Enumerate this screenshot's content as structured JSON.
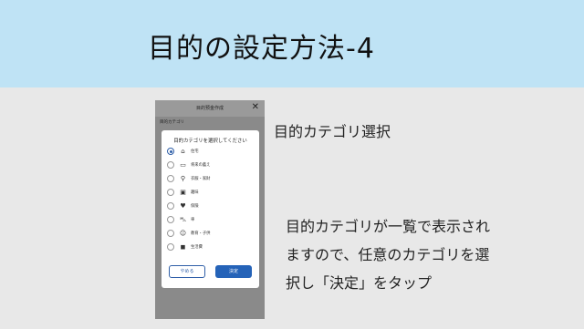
{
  "header": {
    "title": "目的の設定方法-4"
  },
  "phone": {
    "top_title": "目的预金作成",
    "close_glyph": "✕",
    "field_label": "目的カテゴリ",
    "modal": {
      "title": "目的カテゴリを選択してください",
      "options": [
        {
          "icon": "house-icon",
          "glyph": "⌂",
          "label": "住宅"
        },
        {
          "icon": "sofa-icon",
          "glyph": "▭",
          "label": "将来の蓄え"
        },
        {
          "icon": "cart-icon",
          "glyph": "⚲",
          "label": "衣服・家財"
        },
        {
          "icon": "image-icon",
          "glyph": "▣",
          "label": "趣味"
        },
        {
          "icon": "heart-icon",
          "glyph": "♥",
          "label": "保険"
        },
        {
          "icon": "car-icon",
          "glyph": "⛍",
          "label": "車"
        },
        {
          "icon": "family-icon",
          "glyph": "☺",
          "label": "教育・子供"
        },
        {
          "icon": "bag-icon",
          "glyph": "◼",
          "label": "生活費"
        }
      ],
      "selected_index": 0,
      "cancel_label": "やめる",
      "confirm_label": "決定"
    }
  },
  "side": {
    "heading": "目的カテゴリ選択",
    "desc_lines": [
      "目的カテゴリが一覧で表示され",
      "ますので、任意のカテゴリを選",
      "択し「決定」をタップ"
    ]
  },
  "colors": {
    "header_bg": "#bfe3f5",
    "accent": "#2563b8",
    "page_bg": "#e8e8e8"
  }
}
